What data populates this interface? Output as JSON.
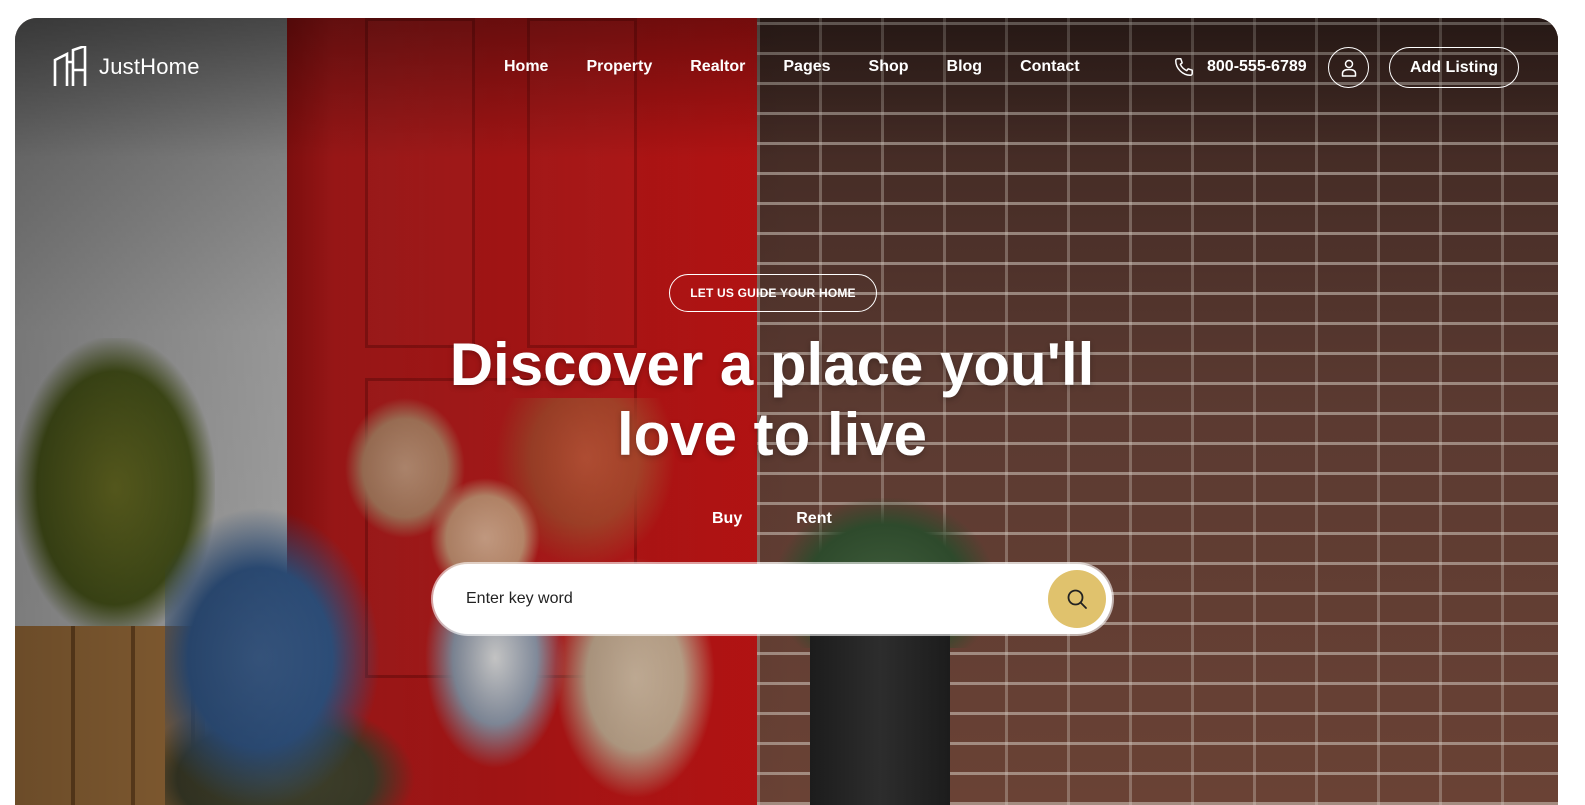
{
  "brand": {
    "name": "JustHome",
    "logo_icon": "building-logo-icon"
  },
  "nav": {
    "items": [
      {
        "label": "Home"
      },
      {
        "label": "Property"
      },
      {
        "label": "Realtor"
      },
      {
        "label": "Pages"
      },
      {
        "label": "Shop"
      },
      {
        "label": "Blog"
      },
      {
        "label": "Contact"
      }
    ]
  },
  "header": {
    "phone": "800-555-6789",
    "phone_icon": "phone-icon",
    "user_icon": "user-icon",
    "add_listing_label": "Add Listing"
  },
  "hero": {
    "tagline": "LET US GUIDE YOUR HOME",
    "headline_line1": "Discover a place you'll",
    "headline_line2": "love to live",
    "tabs": [
      {
        "label": "Buy"
      },
      {
        "label": "Rent"
      }
    ],
    "search": {
      "placeholder": "Enter key word",
      "value": "",
      "button_icon": "search-icon"
    }
  },
  "colors": {
    "accent": "#e0c26d",
    "text_on_hero": "#ffffff",
    "page_background": "#ffffff"
  }
}
